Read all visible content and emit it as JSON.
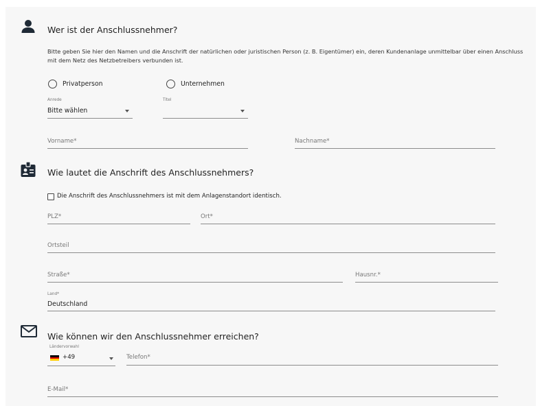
{
  "section_person": {
    "title": "Wer ist der Anschlussnehmer?",
    "intro": "Bitte geben Sie hier den Namen und die Anschrift der natürlichen oder juristischen Person (z. B. Eigentümer) ein, deren Kundenanlage unmittelbar über einen Anschluss mit dem Netz des Netzbetreibers verbunden ist.",
    "radio_private": "Privatperson",
    "radio_company": "Unternehmen",
    "anrede_label": "Anrede",
    "anrede_value": "Bitte wählen",
    "titel_label": "Titel",
    "titel_value": "",
    "vorname_placeholder": "Vorname*",
    "nachname_placeholder": "Nachname*",
    "icon": "person-icon"
  },
  "section_address": {
    "title": "Wie lautet die Anschrift des Anschlussnehmers?",
    "same_address_label": "Die Anschrift des Anschlussnehmers ist mit dem Anlagenstandort identisch.",
    "plz_placeholder": "PLZ*",
    "ort_placeholder": "Ort*",
    "ortsteil_placeholder": "Ortsteil",
    "strasse_placeholder": "Straße*",
    "hausnr_placeholder": "Hausnr.*",
    "land_label": "Land*",
    "land_value": "Deutschland",
    "icon": "id-card-icon"
  },
  "section_contact": {
    "title": "Wie können wir den Anschlussnehmer erreichen?",
    "country_code_label": "Ländervorwahl",
    "country_code_value": "+49",
    "telefon_placeholder": "Telefon*",
    "email_placeholder": "E-Mail*",
    "icon": "envelope-icon"
  },
  "colors": {
    "panel_bg": "#f7f7f7",
    "icon": "#1f2a36",
    "underline": "#8c8c8c",
    "flag_black": "#000000",
    "flag_red": "#dd0000",
    "flag_gold": "#ffce00"
  }
}
